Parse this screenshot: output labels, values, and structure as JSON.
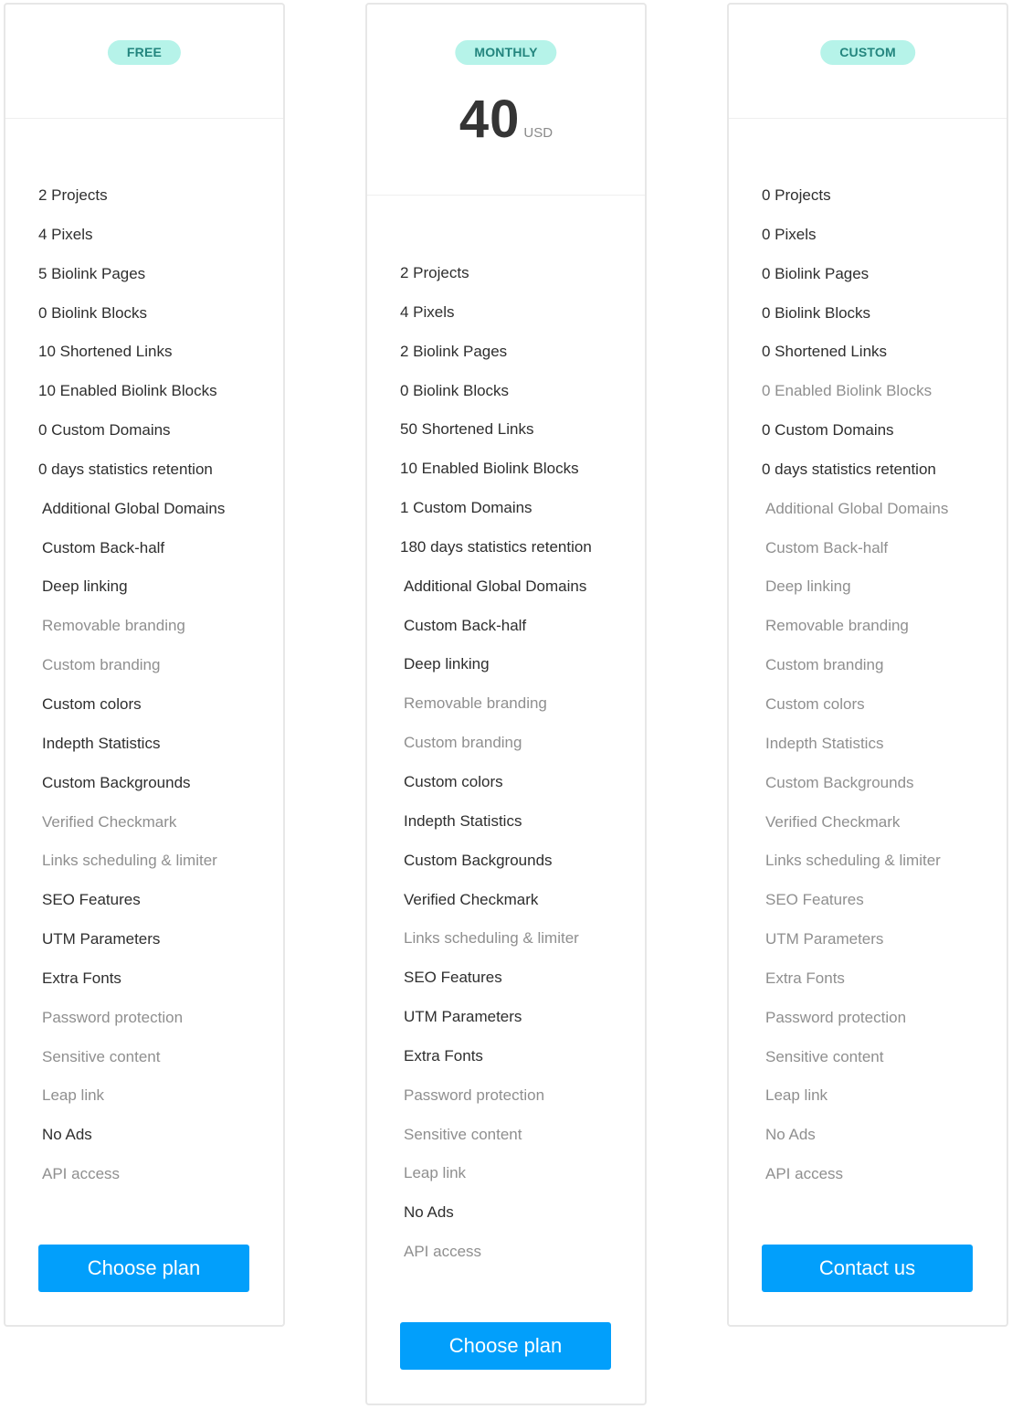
{
  "colors": {
    "badge_bg": "#b6f3e9",
    "badge_text": "#23857e",
    "button_bg": "#029ffb",
    "enabled_text": "#2e2e2e",
    "disabled_text": "#8f8f8f"
  },
  "plans": [
    {
      "id": "free",
      "badge": "FREE",
      "button_label": "Choose plan",
      "features": [
        {
          "label": "2 Projects",
          "enabled": true,
          "kind": "limit"
        },
        {
          "label": "4 Pixels",
          "enabled": true,
          "kind": "limit"
        },
        {
          "label": "5 Biolink Pages",
          "enabled": true,
          "kind": "limit"
        },
        {
          "label": "0 Biolink Blocks",
          "enabled": true,
          "kind": "limit"
        },
        {
          "label": "10 Shortened Links",
          "enabled": true,
          "kind": "limit"
        },
        {
          "label": "10 Enabled Biolink Blocks",
          "enabled": true,
          "kind": "limit"
        },
        {
          "label": "0 Custom Domains",
          "enabled": true,
          "kind": "limit"
        },
        {
          "label": "0 days statistics retention",
          "enabled": true,
          "kind": "limit"
        },
        {
          "label": "Additional Global Domains",
          "enabled": true,
          "kind": "flag"
        },
        {
          "label": "Custom Back-half",
          "enabled": true,
          "kind": "flag"
        },
        {
          "label": "Deep linking",
          "enabled": true,
          "kind": "flag"
        },
        {
          "label": "Removable branding",
          "enabled": false,
          "kind": "flag"
        },
        {
          "label": "Custom branding",
          "enabled": false,
          "kind": "flag"
        },
        {
          "label": "Custom colors",
          "enabled": true,
          "kind": "flag"
        },
        {
          "label": "Indepth Statistics",
          "enabled": true,
          "kind": "flag"
        },
        {
          "label": "Custom Backgrounds",
          "enabled": true,
          "kind": "flag"
        },
        {
          "label": "Verified Checkmark",
          "enabled": false,
          "kind": "flag"
        },
        {
          "label": "Links scheduling & limiter",
          "enabled": false,
          "kind": "flag"
        },
        {
          "label": "SEO Features",
          "enabled": true,
          "kind": "flag"
        },
        {
          "label": "UTM Parameters",
          "enabled": true,
          "kind": "flag"
        },
        {
          "label": "Extra Fonts",
          "enabled": true,
          "kind": "flag"
        },
        {
          "label": "Password protection",
          "enabled": false,
          "kind": "flag"
        },
        {
          "label": "Sensitive content",
          "enabled": false,
          "kind": "flag"
        },
        {
          "label": "Leap link",
          "enabled": false,
          "kind": "flag"
        },
        {
          "label": "No Ads",
          "enabled": true,
          "kind": "flag"
        },
        {
          "label": "API access",
          "enabled": false,
          "kind": "flag"
        }
      ]
    },
    {
      "id": "monthly",
      "badge": "MONTHLY",
      "price": {
        "amount": "40",
        "currency": "USD"
      },
      "button_label": "Choose plan",
      "features": [
        {
          "label": "2 Projects",
          "enabled": true,
          "kind": "limit"
        },
        {
          "label": "4 Pixels",
          "enabled": true,
          "kind": "limit"
        },
        {
          "label": "2 Biolink Pages",
          "enabled": true,
          "kind": "limit"
        },
        {
          "label": "0 Biolink Blocks",
          "enabled": true,
          "kind": "limit"
        },
        {
          "label": "50 Shortened Links",
          "enabled": true,
          "kind": "limit"
        },
        {
          "label": "10 Enabled Biolink Blocks",
          "enabled": true,
          "kind": "limit"
        },
        {
          "label": "1 Custom Domains",
          "enabled": true,
          "kind": "limit"
        },
        {
          "label": "180 days statistics retention",
          "enabled": true,
          "kind": "limit"
        },
        {
          "label": "Additional Global Domains",
          "enabled": true,
          "kind": "flag"
        },
        {
          "label": "Custom Back-half",
          "enabled": true,
          "kind": "flag"
        },
        {
          "label": "Deep linking",
          "enabled": true,
          "kind": "flag"
        },
        {
          "label": "Removable branding",
          "enabled": false,
          "kind": "flag"
        },
        {
          "label": "Custom branding",
          "enabled": false,
          "kind": "flag"
        },
        {
          "label": "Custom colors",
          "enabled": true,
          "kind": "flag"
        },
        {
          "label": "Indepth Statistics",
          "enabled": true,
          "kind": "flag"
        },
        {
          "label": "Custom Backgrounds",
          "enabled": true,
          "kind": "flag"
        },
        {
          "label": "Verified Checkmark",
          "enabled": true,
          "kind": "flag"
        },
        {
          "label": "Links scheduling & limiter",
          "enabled": false,
          "kind": "flag"
        },
        {
          "label": "SEO Features",
          "enabled": true,
          "kind": "flag"
        },
        {
          "label": "UTM Parameters",
          "enabled": true,
          "kind": "flag"
        },
        {
          "label": "Extra Fonts",
          "enabled": true,
          "kind": "flag"
        },
        {
          "label": "Password protection",
          "enabled": false,
          "kind": "flag"
        },
        {
          "label": "Sensitive content",
          "enabled": false,
          "kind": "flag"
        },
        {
          "label": "Leap link",
          "enabled": false,
          "kind": "flag"
        },
        {
          "label": "No Ads",
          "enabled": true,
          "kind": "flag"
        },
        {
          "label": "API access",
          "enabled": false,
          "kind": "flag"
        }
      ]
    },
    {
      "id": "custom",
      "badge": "CUSTOM",
      "button_label": "Contact us",
      "features": [
        {
          "label": "0 Projects",
          "enabled": true,
          "kind": "limit"
        },
        {
          "label": "0 Pixels",
          "enabled": true,
          "kind": "limit"
        },
        {
          "label": "0 Biolink Pages",
          "enabled": true,
          "kind": "limit"
        },
        {
          "label": "0 Biolink Blocks",
          "enabled": true,
          "kind": "limit"
        },
        {
          "label": "0 Shortened Links",
          "enabled": true,
          "kind": "limit"
        },
        {
          "label": "0 Enabled Biolink Blocks",
          "enabled": false,
          "kind": "limit"
        },
        {
          "label": "0 Custom Domains",
          "enabled": true,
          "kind": "limit"
        },
        {
          "label": "0 days statistics retention",
          "enabled": true,
          "kind": "limit"
        },
        {
          "label": "Additional Global Domains",
          "enabled": false,
          "kind": "flag"
        },
        {
          "label": "Custom Back-half",
          "enabled": false,
          "kind": "flag"
        },
        {
          "label": "Deep linking",
          "enabled": false,
          "kind": "flag"
        },
        {
          "label": "Removable branding",
          "enabled": false,
          "kind": "flag"
        },
        {
          "label": "Custom branding",
          "enabled": false,
          "kind": "flag"
        },
        {
          "label": "Custom colors",
          "enabled": false,
          "kind": "flag"
        },
        {
          "label": "Indepth Statistics",
          "enabled": false,
          "kind": "flag"
        },
        {
          "label": "Custom Backgrounds",
          "enabled": false,
          "kind": "flag"
        },
        {
          "label": "Verified Checkmark",
          "enabled": false,
          "kind": "flag"
        },
        {
          "label": "Links scheduling & limiter",
          "enabled": false,
          "kind": "flag"
        },
        {
          "label": "SEO Features",
          "enabled": false,
          "kind": "flag"
        },
        {
          "label": "UTM Parameters",
          "enabled": false,
          "kind": "flag"
        },
        {
          "label": "Extra Fonts",
          "enabled": false,
          "kind": "flag"
        },
        {
          "label": "Password protection",
          "enabled": false,
          "kind": "flag"
        },
        {
          "label": "Sensitive content",
          "enabled": false,
          "kind": "flag"
        },
        {
          "label": "Leap link",
          "enabled": false,
          "kind": "flag"
        },
        {
          "label": "No Ads",
          "enabled": false,
          "kind": "flag"
        },
        {
          "label": "API access",
          "enabled": false,
          "kind": "flag"
        }
      ]
    }
  ]
}
